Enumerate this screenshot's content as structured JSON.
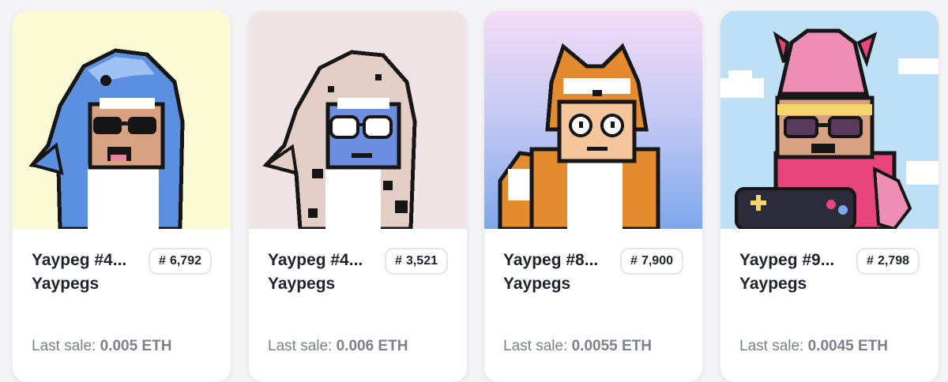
{
  "cards": [
    {
      "title": "Yaypeg #4...",
      "rank_hash": "#",
      "rank": "6,792",
      "collection": "Yaypegs",
      "last_sale_label": "Last sale:",
      "last_sale_price": "0.005 ETH",
      "art_bg": "#fbfbd6",
      "art": "blue-shark-costume"
    },
    {
      "title": "Yaypeg #4...",
      "rank_hash": "#",
      "rank": "3,521",
      "collection": "Yaypegs",
      "last_sale_label": "Last sale:",
      "last_sale_price": "0.006 ETH",
      "art_bg": "#f1e4e6",
      "art": "spotted-shark-costume"
    },
    {
      "title": "Yaypeg #8...",
      "rank_hash": "#",
      "rank": "7,900",
      "collection": "Yaypegs",
      "last_sale_label": "Last sale:",
      "last_sale_price": "0.0055 ETH",
      "art_bg": "#c9c9f5",
      "art": "shiba-costume"
    },
    {
      "title": "Yaypeg #9...",
      "rank_hash": "#",
      "rank": "2,798",
      "collection": "Yaypegs",
      "last_sale_label": "Last sale:",
      "last_sale_price": "0.0045 ETH",
      "art_bg": "#bde0f7",
      "art": "squid-costume"
    }
  ]
}
